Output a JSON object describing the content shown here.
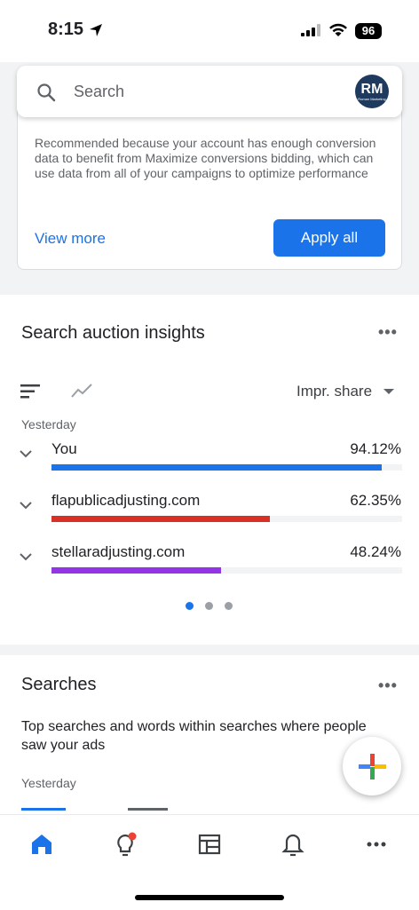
{
  "status_bar": {
    "time": "8:15",
    "battery": "96"
  },
  "search": {
    "placeholder": "Search",
    "avatar_initials": "RM",
    "avatar_subtext": "Roman Marketing"
  },
  "recommendation": {
    "text": "Recommended because your account has enough conversion data to benefit from Maximize conversions bidding, which can use data from all of your campaigns to optimize performance",
    "view_more": "View more",
    "apply_all": "Apply all"
  },
  "auction": {
    "title": "Search auction insights",
    "metric": "Impr. share",
    "period": "Yesterday",
    "rows": [
      {
        "name": "You",
        "pct": "94.12%",
        "value": 0.9412,
        "color": "#1a73e8"
      },
      {
        "name": "flapublicadjusting.com",
        "pct": "62.35%",
        "value": 0.6235,
        "color": "#d93025"
      },
      {
        "name": "stellaradjusting.com",
        "pct": "48.24%",
        "value": 0.4824,
        "color": "#9334e6"
      }
    ],
    "page_count": 3,
    "active_page": 1
  },
  "searches": {
    "title": "Searches",
    "description": "Top searches and words within searches where people saw your ads",
    "period": "Yesterday"
  },
  "colors": {
    "accent": "#1a73e8",
    "background_gray": "#f1f3f4"
  },
  "nav": {
    "items": [
      {
        "icon": "home-icon",
        "active": true
      },
      {
        "icon": "lightbulb-icon",
        "badge": true
      },
      {
        "icon": "table-icon"
      },
      {
        "icon": "bell-icon"
      },
      {
        "icon": "more-icon"
      }
    ]
  }
}
